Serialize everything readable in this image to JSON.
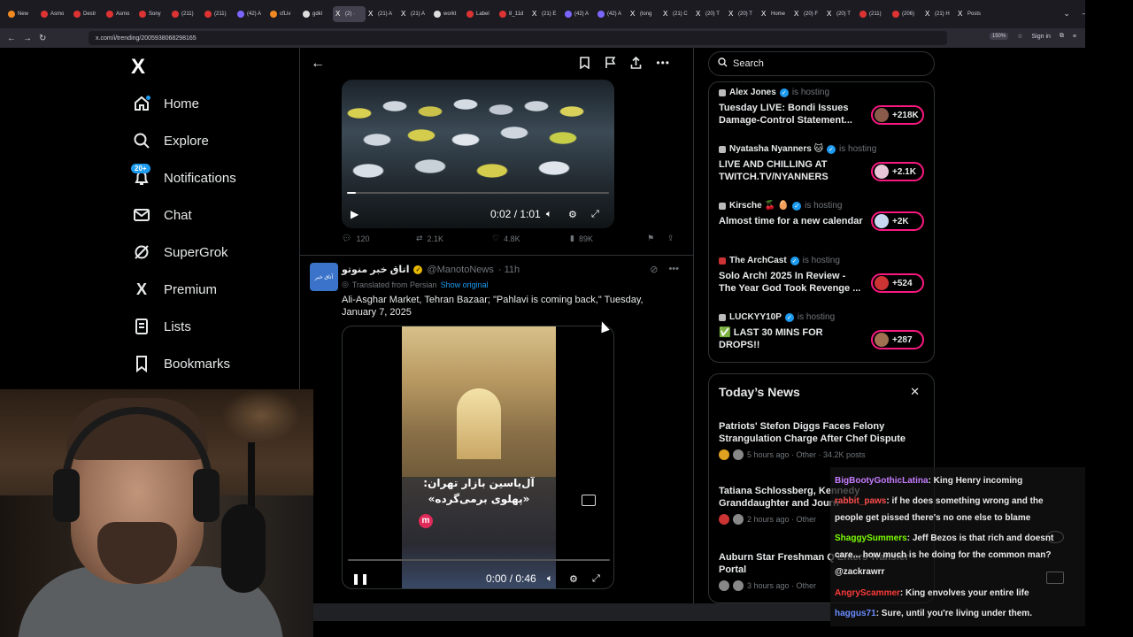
{
  "browser": {
    "tabs": [
      {
        "label": "New",
        "icon": "o"
      },
      {
        "label": "Asmo",
        "icon": "r"
      },
      {
        "label": "Destr",
        "icon": "r"
      },
      {
        "label": "Asmo",
        "icon": "r"
      },
      {
        "label": "Sony",
        "icon": "r"
      },
      {
        "label": "(211)",
        "icon": "r"
      },
      {
        "label": "(211)",
        "icon": "r"
      },
      {
        "label": "(42) A",
        "icon": "g"
      },
      {
        "label": "cfLiv",
        "icon": "o"
      },
      {
        "label": "gdkl",
        "icon": "w"
      },
      {
        "label": "(2) ·",
        "icon": "x"
      },
      {
        "label": "(21) A",
        "icon": "x"
      },
      {
        "label": "(21) A",
        "icon": "x"
      },
      {
        "label": "workt",
        "icon": "w"
      },
      {
        "label": "Label",
        "icon": "r"
      },
      {
        "label": "8_11d",
        "icon": "r"
      },
      {
        "label": "(21) E",
        "icon": "x"
      },
      {
        "label": "(42) A",
        "icon": "g"
      },
      {
        "label": "(42) A",
        "icon": "g"
      },
      {
        "label": "(long",
        "icon": "x"
      },
      {
        "label": "(21) C",
        "icon": "x"
      },
      {
        "label": "(20) T",
        "icon": "x"
      },
      {
        "label": "(20) T",
        "icon": "x"
      },
      {
        "label": "Home",
        "icon": "x"
      },
      {
        "label": "(20) F",
        "icon": "x"
      },
      {
        "label": "(20) T",
        "icon": "x"
      },
      {
        "label": "(211)",
        "icon": "r"
      },
      {
        "label": "(206)",
        "icon": "r"
      },
      {
        "label": "(21) H",
        "icon": "x"
      },
      {
        "label": "Posts",
        "icon": "x"
      }
    ],
    "active_tab_index": 10,
    "url": "x.com/i/trending/2005938068298165",
    "zoom": "150%",
    "sign_in": "Sign in"
  },
  "nav": {
    "logo": "X",
    "items": [
      {
        "label": "Home",
        "icon": "home-icon"
      },
      {
        "label": "Explore",
        "icon": "search-icon"
      },
      {
        "label": "Notifications",
        "icon": "bell-icon",
        "badge": "20+"
      },
      {
        "label": "Chat",
        "icon": "mail-icon"
      },
      {
        "label": "SuperGrok",
        "icon": "grok-icon"
      },
      {
        "label": "Premium",
        "icon": "x-icon"
      },
      {
        "label": "Lists",
        "icon": "list-icon"
      },
      {
        "label": "Bookmarks",
        "icon": "bookmark-icon"
      }
    ]
  },
  "video1": {
    "time": "0:02 / 1:01",
    "progress": 0.033
  },
  "metrics1": {
    "replies": "120",
    "reposts": "2.1K",
    "likes": "4.8K",
    "views": "89K"
  },
  "tweet2": {
    "avatar_text": "آتاق خبر",
    "name": "اتاق خبر منوتو",
    "handle": "@ManotoNews",
    "time": "· 11h",
    "translated": "Translated from Persian",
    "show_original": "Show original",
    "text": "Ali-Asghar Market, Tehran Bazaar; \"Pahlavi is coming back,\" Tuesday, January 7, 2025",
    "video_caption_line1": "آل‌یاسین بازار تهران:",
    "video_caption_line2": "«پهلوی برمی‌گرده»",
    "video_logo": "m",
    "video_time": "0:00 / 0:46",
    "progress": 0.0
  },
  "search": {
    "placeholder": "Search"
  },
  "live": [
    {
      "host": "Alex Jones",
      "hosting": "is hosting",
      "title": "Tuesday LIVE: Bondi Issues Damage-Control Statement...",
      "count": "+218K"
    },
    {
      "host": "Nyatasha Nyanners 🐱",
      "hosting": "is hosting",
      "title": "LIVE AND CHILLING AT TWITCH.TV/NYANNERS",
      "count": "+2.1K"
    },
    {
      "host": "Kirsche 🍒 🥚",
      "hosting": "is hosting",
      "title": "Almost time for a new calendar",
      "count": "+2K"
    },
    {
      "host": "The ArchCast",
      "hosting": "is hosting",
      "title": "Solo Arch! 2025 In Review - The Year God Took Revenge ...",
      "count": "+524"
    },
    {
      "host": "LUCKYY10P",
      "hosting": "is hosting",
      "title": "✅ LAST 30 MINS FOR DROPS!!",
      "count": "+287"
    }
  ],
  "news": {
    "title": "Today’s News",
    "items": [
      {
        "headline": "Patriots' Stefon Diggs Faces Felony Strangulation Charge After Chef Dispute",
        "meta": "5 hours ago · Other · 34.2K posts"
      },
      {
        "headline": "Tatiana Schlossberg, Kennedy Granddaughter and Journ",
        "meta": "2 hours ago · Other"
      },
      {
        "headline": "Auburn Star Freshman Q Enters Transfer Portal",
        "meta": "3 hours ago · Other"
      }
    ]
  },
  "chat": [
    {
      "user": "BigBootyGothicLatina",
      "color": "#c77dff",
      "msg": "King Henry incoming"
    },
    {
      "user": "rabbit_paws",
      "color": "#ff4d4d",
      "msg": "if he does something wrong and the people get pissed there's no one else to blame"
    },
    {
      "user": "ShaggySummers",
      "color": "#7cfc00",
      "msg": "Jeff Bezos is that rich and doesnt care... how much is he doing for the common man? @zackrawrr"
    },
    {
      "user": "AngryScammer",
      "color": "#ff3b3b",
      "msg": "King envolves your entire life"
    },
    {
      "user": "haggus71",
      "color": "#6a8dff",
      "msg": "Sure, until you're living under them."
    }
  ]
}
